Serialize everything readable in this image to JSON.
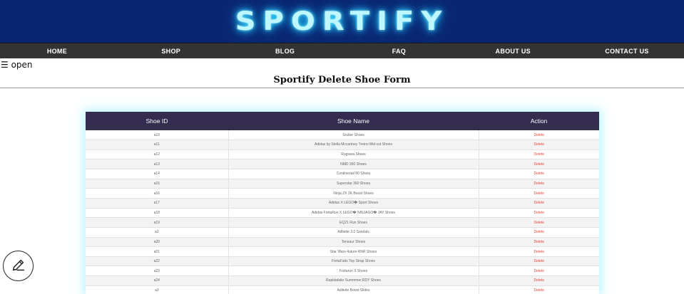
{
  "header": {
    "logo": "SPORTIFY"
  },
  "nav": {
    "items": [
      {
        "label": "HOME"
      },
      {
        "label": "SHOP"
      },
      {
        "label": "BLOG"
      },
      {
        "label": "FAQ"
      },
      {
        "label": "ABOUT US"
      },
      {
        "label": "CONTACT US"
      }
    ]
  },
  "toggle": {
    "label": "☰ open"
  },
  "page": {
    "title": "Sportify Delete Shoe Form"
  },
  "table": {
    "columns": [
      "Shoe ID",
      "Shoe Name",
      "Action"
    ],
    "rows": [
      {
        "id": "a10",
        "name": "Srutter Shoes",
        "action": "Delete"
      },
      {
        "id": "a11",
        "name": "Adidas by Stella Mccartney Treino Mid-cut Shoes",
        "action": "Delete"
      },
      {
        "id": "a12",
        "name": "Rugsara Shoes",
        "action": "Delete"
      },
      {
        "id": "a13",
        "name": "NMD 360 Shoes",
        "action": "Delete"
      },
      {
        "id": "a14",
        "name": "Continental 80 Shoes",
        "action": "Delete"
      },
      {
        "id": "a15",
        "name": "Superstar 360 Shoes",
        "action": "Delete"
      },
      {
        "id": "a16",
        "name": "Ninja ZX 2K Boost Shoes",
        "action": "Delete"
      },
      {
        "id": "a17",
        "name": "Adidas X LEGO� Sport Shoes",
        "action": "Delete"
      },
      {
        "id": "a18",
        "name": "Adidas FortaRun X LEGO� NINJAGO� JAY Shoes",
        "action": "Delete"
      },
      {
        "id": "a19",
        "name": "EQ21 Run Shoes",
        "action": "Delete"
      },
      {
        "id": "a2",
        "name": "Adilette 3.0 Sandals",
        "action": "Delete"
      },
      {
        "id": "a20",
        "name": "Tensaur Shoes",
        "action": "Delete"
      },
      {
        "id": "a21",
        "name": "Star Wars 4uture RNR Shoes",
        "action": "Delete"
      },
      {
        "id": "a22",
        "name": "FortaFaito Top Strap Shoes",
        "action": "Delete"
      },
      {
        "id": "a23",
        "name": "Fortarun X Shoes",
        "action": "Delete"
      },
      {
        "id": "a24",
        "name": "Rapidafaito Summmer.RDY Shoes",
        "action": "Delete"
      },
      {
        "id": "a3",
        "name": "Adilette Boost Slides",
        "action": "Delete"
      }
    ]
  },
  "fab": {
    "icon": "pencil-icon"
  },
  "colors": {
    "banner": "#0a2672",
    "logo_glow": "#2fd6ff",
    "nav_bg": "#333333",
    "table_header": "#342d4f",
    "delete_link": "#e0443b"
  }
}
